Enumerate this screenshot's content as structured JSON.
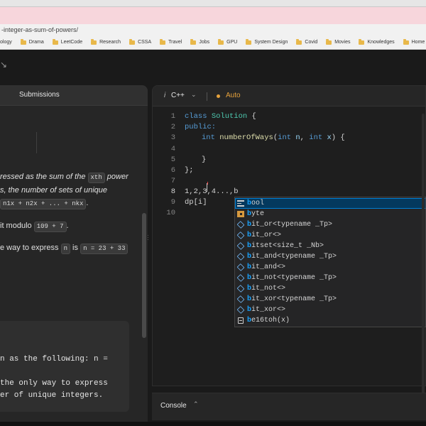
{
  "browser": {
    "url_fragment": "-integer-as-sum-of-powers/",
    "bookmarks": [
      "ology",
      "Drama",
      "LeetCode",
      "Research",
      "CSSA",
      "Travel",
      "Jobs",
      "GPU",
      "System Design",
      "Covid",
      "Movies",
      "Knowledges",
      "Home"
    ]
  },
  "left_panel": {
    "tab_label": "Submissions",
    "desc": {
      "line1_a": "ressed as the sum of the ",
      "line1_chip": "xth",
      "line1_b": " power",
      "line2": "s, the number of sets of unique",
      "line3_chip": "n1x + n2x + ... + nkx",
      "line3_end": ".",
      "line4_a": "it modulo ",
      "line4_chip": "109 + 7",
      "line4_b": ".",
      "line5_a": "e way to express ",
      "line5_chip1": "n",
      "line5_b": " is ",
      "line5_chip2": "n = 23 + 33"
    },
    "example": {
      "line1": "n as the following: n =",
      "line2": "the only way to express",
      "line3": "er of unique integers."
    }
  },
  "editor": {
    "lang_prefix": "i",
    "language": "C++",
    "mode": "Auto",
    "lines": [
      {
        "num": "1"
      },
      {
        "num": "2"
      },
      {
        "num": "3"
      },
      {
        "num": "4"
      },
      {
        "num": "5"
      },
      {
        "num": "6"
      },
      {
        "num": "7"
      },
      {
        "num": "8"
      },
      {
        "num": "9"
      },
      {
        "num": "10"
      }
    ],
    "code": {
      "l1_kw": "class",
      "l1_ty": "Solution",
      "l1_rest": " {",
      "l2": "public:",
      "l3_kw": "int",
      "l3_fn": "numberOfWays",
      "l3_p1": "(",
      "l3_kw2": "int",
      "l3_pm1": " n",
      "l3_p2": ", ",
      "l3_kw3": "int",
      "l3_pm2": " x",
      "l3_p3": ") {",
      "l5": "}",
      "l6": "};",
      "l8": "1,2,3,4...,b",
      "l9": "dp[i]"
    }
  },
  "autocomplete": {
    "items": [
      {
        "icon": "keyword",
        "match": "b",
        "rest": "ool"
      },
      {
        "icon": "class",
        "match": "b",
        "rest": "yte"
      },
      {
        "icon": "field",
        "match": "b",
        "rest": "it_or<typename _Tp>"
      },
      {
        "icon": "field",
        "match": "b",
        "rest": "it_or<>"
      },
      {
        "icon": "field",
        "match": "b",
        "rest": "itset<size_t _Nb>"
      },
      {
        "icon": "field",
        "match": "b",
        "rest": "it_and<typename _Tp>"
      },
      {
        "icon": "field",
        "match": "b",
        "rest": "it_and<>"
      },
      {
        "icon": "field",
        "match": "b",
        "rest": "it_not<typename _Tp>"
      },
      {
        "icon": "field",
        "match": "b",
        "rest": "it_not<>"
      },
      {
        "icon": "field",
        "match": "b",
        "rest": "it_xor<typename _Tp>"
      },
      {
        "icon": "field",
        "match": "b",
        "rest": "it_xor<>"
      },
      {
        "icon": "document",
        "match": "b",
        "rest": "e16toh(x)"
      }
    ]
  },
  "console": {
    "label": "Console"
  },
  "colors": {
    "accent": "#e6a23c",
    "suggest_match": "#18a3ff",
    "suggest_selected": "#04395e"
  }
}
